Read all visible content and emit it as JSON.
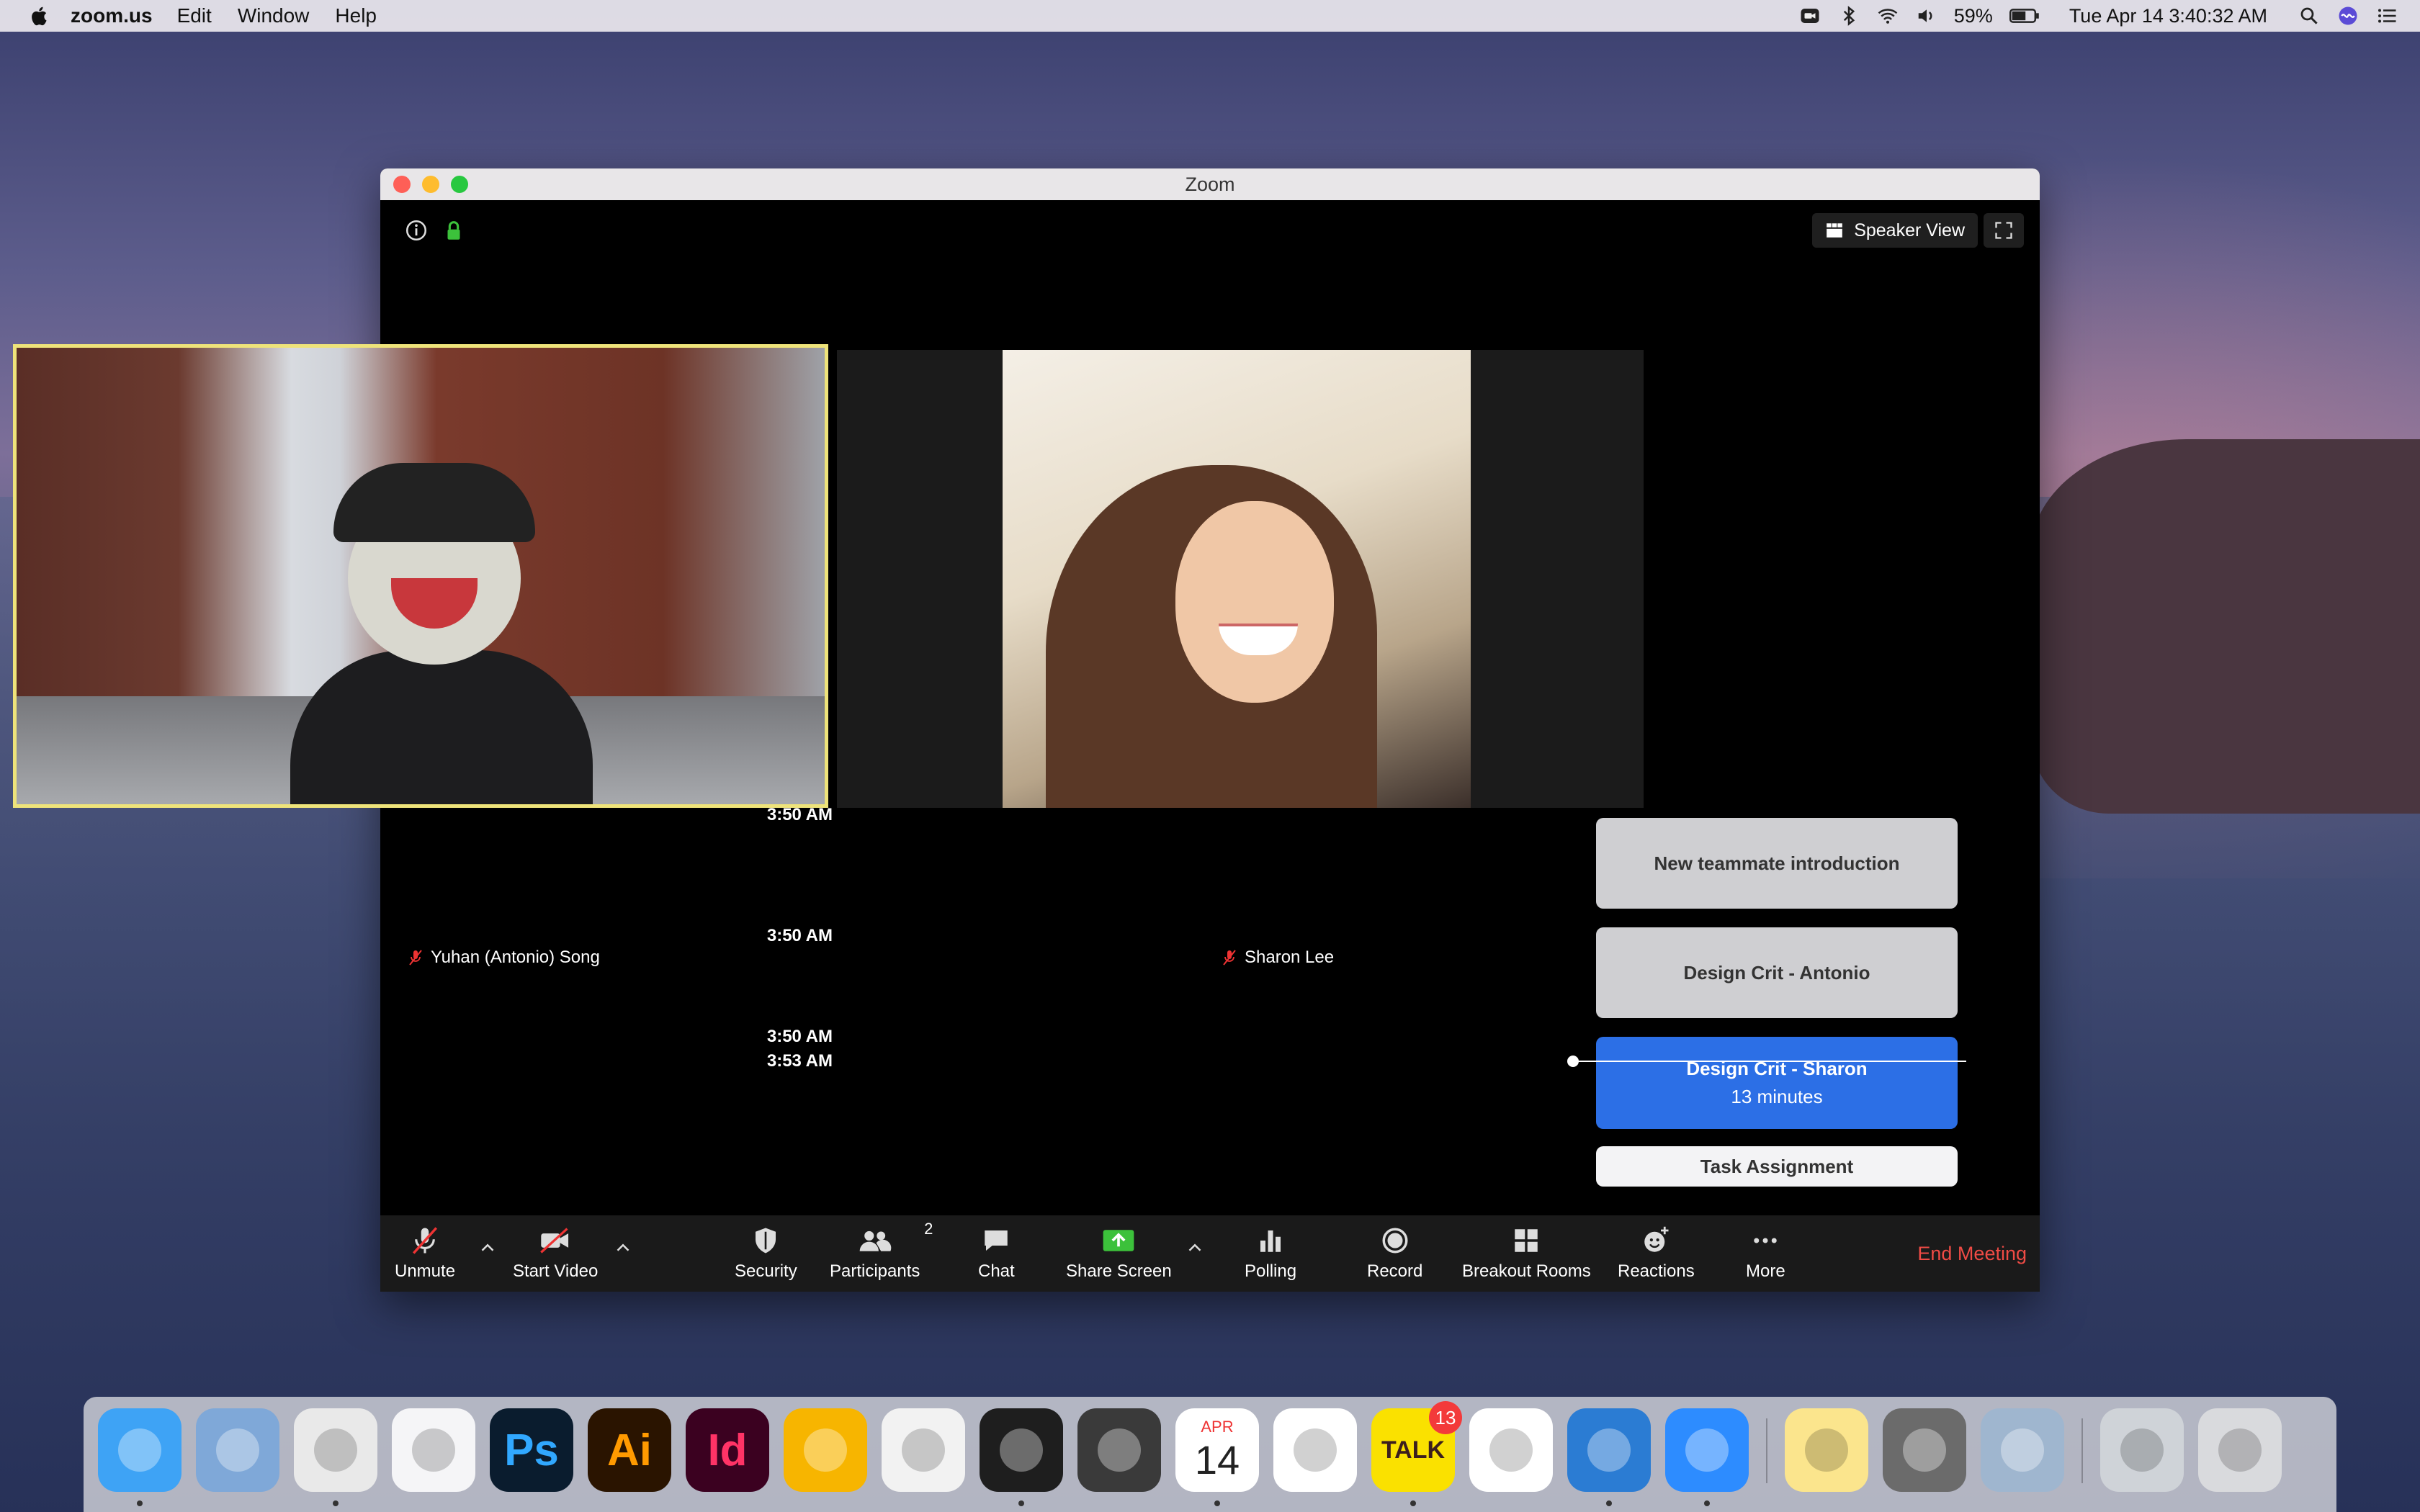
{
  "menubar": {
    "app_name": "zoom.us",
    "menus": [
      "Edit",
      "Window",
      "Help"
    ],
    "battery": "59%",
    "datetime": "Tue Apr 14  3:40:32 AM"
  },
  "window": {
    "title": "Zoom",
    "speaker_view_label": "Speaker View"
  },
  "participants": [
    {
      "name": "Yuhan (Antonio) Song",
      "muted": true,
      "active_speaker": true
    },
    {
      "name": "Sharon Lee",
      "muted": true,
      "active_speaker": false
    }
  ],
  "agenda": {
    "items": [
      {
        "time": "3:50 AM",
        "title": "New teammate introduction",
        "state": "past"
      },
      {
        "time": "3:50 AM",
        "title": "Design Crit - Antonio",
        "state": "past"
      },
      {
        "time": "3:50 AM",
        "title": "Design Crit - Sharon",
        "subtitle": "13 minutes",
        "state": "current"
      },
      {
        "title": "Task Assignment",
        "state": "upcoming"
      }
    ],
    "now_time": "3:53 AM"
  },
  "toolbar": {
    "unmute": "Unmute",
    "start_video": "Start Video",
    "security": "Security",
    "participants": "Participants",
    "participants_count": "2",
    "chat": "Chat",
    "share_screen": "Share Screen",
    "polling": "Polling",
    "record": "Record",
    "breakout_rooms": "Breakout Rooms",
    "reactions": "Reactions",
    "more": "More",
    "end_meeting": "End Meeting"
  },
  "dock": {
    "apps": [
      {
        "name": "finder-icon",
        "label": "",
        "color": "#3ea3f5"
      },
      {
        "name": "mail-icon",
        "label": "",
        "color": "#7fa8d8"
      },
      {
        "name": "chrome-icon",
        "label": "",
        "color": "#e9e9e9"
      },
      {
        "name": "music-icon",
        "label": "",
        "color": "#f5f5f7"
      },
      {
        "name": "photoshop-icon",
        "label": "Ps",
        "color": "#0a1c2e"
      },
      {
        "name": "illustrator-icon",
        "label": "Ai",
        "color": "#2a1400"
      },
      {
        "name": "indesign-icon",
        "label": "Id",
        "color": "#3b0120"
      },
      {
        "name": "sketch-icon",
        "label": "",
        "color": "#f7b500"
      },
      {
        "name": "picsart-icon",
        "label": "",
        "color": "#f2f2f2"
      },
      {
        "name": "figma-icon",
        "label": "",
        "color": "#1e1e1e"
      },
      {
        "name": "digital-color-meter-icon",
        "label": "",
        "color": "#3a3a3a"
      },
      {
        "name": "calendar-icon",
        "label": "14",
        "month": "APR",
        "color": "#ffffff"
      },
      {
        "name": "slack-icon",
        "label": "",
        "color": "#ffffff"
      },
      {
        "name": "kakaotalk-icon",
        "label": "TALK",
        "badge": "13",
        "color": "#fae100"
      },
      {
        "name": "dropbox-icon",
        "label": "",
        "color": "#ffffff"
      },
      {
        "name": "todo-icon",
        "label": "",
        "color": "#2b7cd3"
      },
      {
        "name": "zoom-icon",
        "label": "",
        "color": "#2d8cff"
      },
      {
        "name": "notes-icon",
        "label": "",
        "color": "#fbe58d"
      },
      {
        "name": "system-preferences-icon",
        "label": "",
        "color": "#6b6b6b"
      },
      {
        "name": "preview-icon",
        "label": "",
        "color": "#9fb6cf"
      },
      {
        "name": "downloads-icon",
        "label": "",
        "color": "#cfd3d8"
      },
      {
        "name": "trash-icon",
        "label": "",
        "color": "#d9dadd"
      }
    ]
  }
}
